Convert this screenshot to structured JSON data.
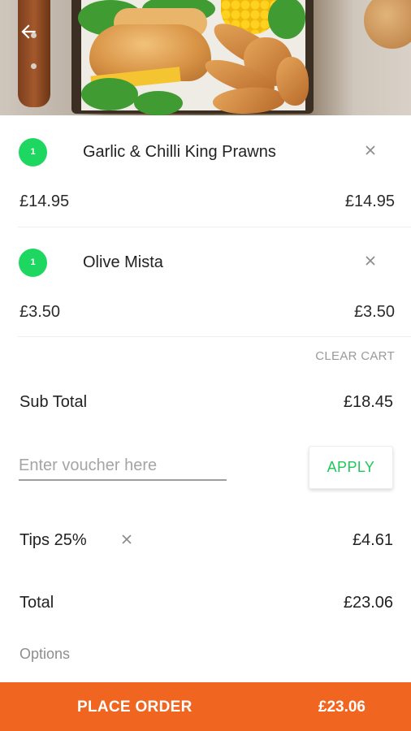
{
  "header": {
    "back_icon": "arrow-left-icon",
    "hero_image": "food-tray-burger-wedges"
  },
  "cart": {
    "items": [
      {
        "qty": "1",
        "name": "Garlic & Chilli King Prawns",
        "unit_price": "£14.95",
        "line_total": "£14.95",
        "remove_icon": "close-icon"
      },
      {
        "qty": "1",
        "name": "Olive Mista",
        "unit_price": "£3.50",
        "line_total": "£3.50",
        "remove_icon": "close-icon"
      }
    ],
    "clear_label": "CLEAR CART"
  },
  "summary": {
    "subtotal_label": "Sub Total",
    "subtotal_value": "£18.45",
    "voucher_placeholder": "Enter voucher here",
    "voucher_value": "",
    "apply_label": "APPLY",
    "tips_label": "Tips 25%",
    "tips_value": "£4.61",
    "tips_remove_icon": "close-icon",
    "total_label": "Total",
    "total_value": "£23.06",
    "options_label": "Options"
  },
  "footer": {
    "place_order_label": "PLACE ORDER",
    "place_order_total": "£23.06"
  },
  "colors": {
    "accent_green": "#1ED760",
    "apply_green": "#1EC95A",
    "order_orange": "#F0651F"
  }
}
